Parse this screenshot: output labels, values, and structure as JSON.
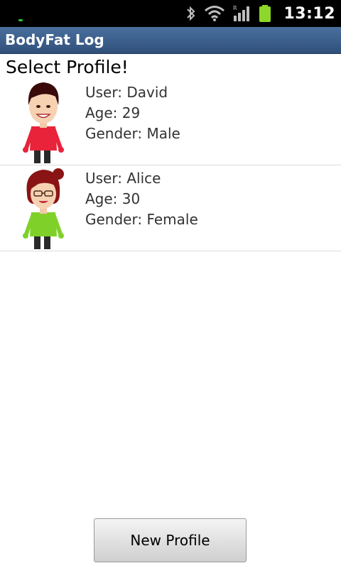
{
  "status_bar": {
    "time": "13:12",
    "icons": [
      "bluetooth-icon",
      "wifi-icon",
      "signal-icon",
      "battery-icon"
    ],
    "signal_label": "R"
  },
  "app": {
    "title": "BodyFat Log"
  },
  "page": {
    "heading": "Select Profile!"
  },
  "profiles": [
    {
      "user": "User: David",
      "age": "Age: 29",
      "gender": "Gender: Male",
      "shirt_color": "#e8233a",
      "hair_color": "#3a0a0a"
    },
    {
      "user": "User: Alice",
      "age": "Age: 30",
      "gender": "Gender: Female",
      "shirt_color": "#7fd12a",
      "hair_color": "#8a1414"
    }
  ],
  "actions": {
    "new_profile_label": "New Profile"
  },
  "colors": {
    "title_bar": "#3d5f8c",
    "status_bar": "#000000",
    "divider": "#dadada"
  }
}
